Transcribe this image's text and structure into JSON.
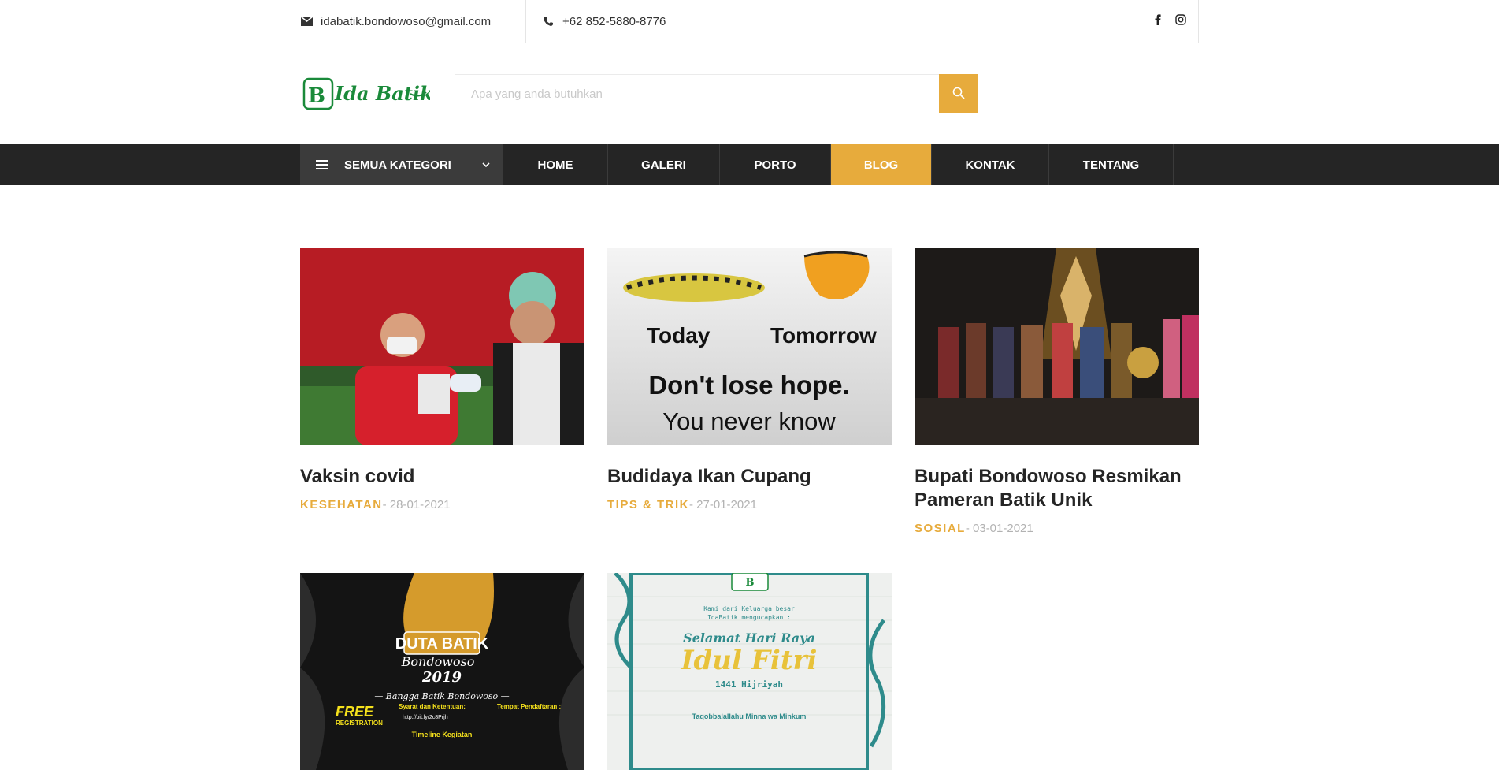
{
  "topbar": {
    "email": "idabatik.bondowoso@gmail.com",
    "phone": "+62 852-5880-8776"
  },
  "logo": {
    "text": "Ida Batik"
  },
  "search": {
    "placeholder": "Apa yang anda butuhkan"
  },
  "nav": {
    "department_label": "SEMUA KATEGORI",
    "items": [
      {
        "label": "HOME"
      },
      {
        "label": "GALERI"
      },
      {
        "label": "PORTO"
      },
      {
        "label": "BLOG",
        "active": true
      },
      {
        "label": "KONTAK"
      },
      {
        "label": "TENTANG"
      }
    ]
  },
  "posts": [
    {
      "title": "Vaksin covid",
      "category": "KESEHATAN",
      "date": "- 28-01-2021"
    },
    {
      "title": "Budidaya Ikan Cupang",
      "category": "TIPS & TRIK",
      "date": "- 27-01-2021",
      "image_text": {
        "left": "Today",
        "right": "Tomorrow",
        "line1": "Don't lose hope.",
        "line2": "You never know"
      }
    },
    {
      "title": "Bupati Bondowoso Resmikan Pameran Batik Unik",
      "category": "SOSIAL",
      "date": "- 03-01-2021"
    },
    {
      "title": "",
      "category": "",
      "date": "",
      "image_text": {
        "headline": "DUTA BATIK",
        "sub": "Bondowoso",
        "year": "2019",
        "tag": "— Bangga Batik Bondowoso —",
        "free": "FREE",
        "reg": "REGISTRATION",
        "syarat": "Syarat dan Ketentuan:",
        "tempat": "Tempat Pendaftaran :",
        "link": "http://bit.ly/2c8Prjh",
        "timeline": "Timeline Kegiatan"
      }
    },
    {
      "title": "",
      "category": "",
      "date": "",
      "image_text": {
        "top": "Kami dari Keluarga besar",
        "top2": "IdaBatik mengucapkan :",
        "greet": "Selamat Hari Raya",
        "main": "Idul Fitri",
        "year": "1441 Hijriyah",
        "bottom": "Taqobbalallahu Minna wa Minkum"
      }
    }
  ],
  "colors": {
    "accent": "#e7ab3c",
    "nav_bg": "#252525",
    "dept_bg": "#3b3b3b"
  }
}
